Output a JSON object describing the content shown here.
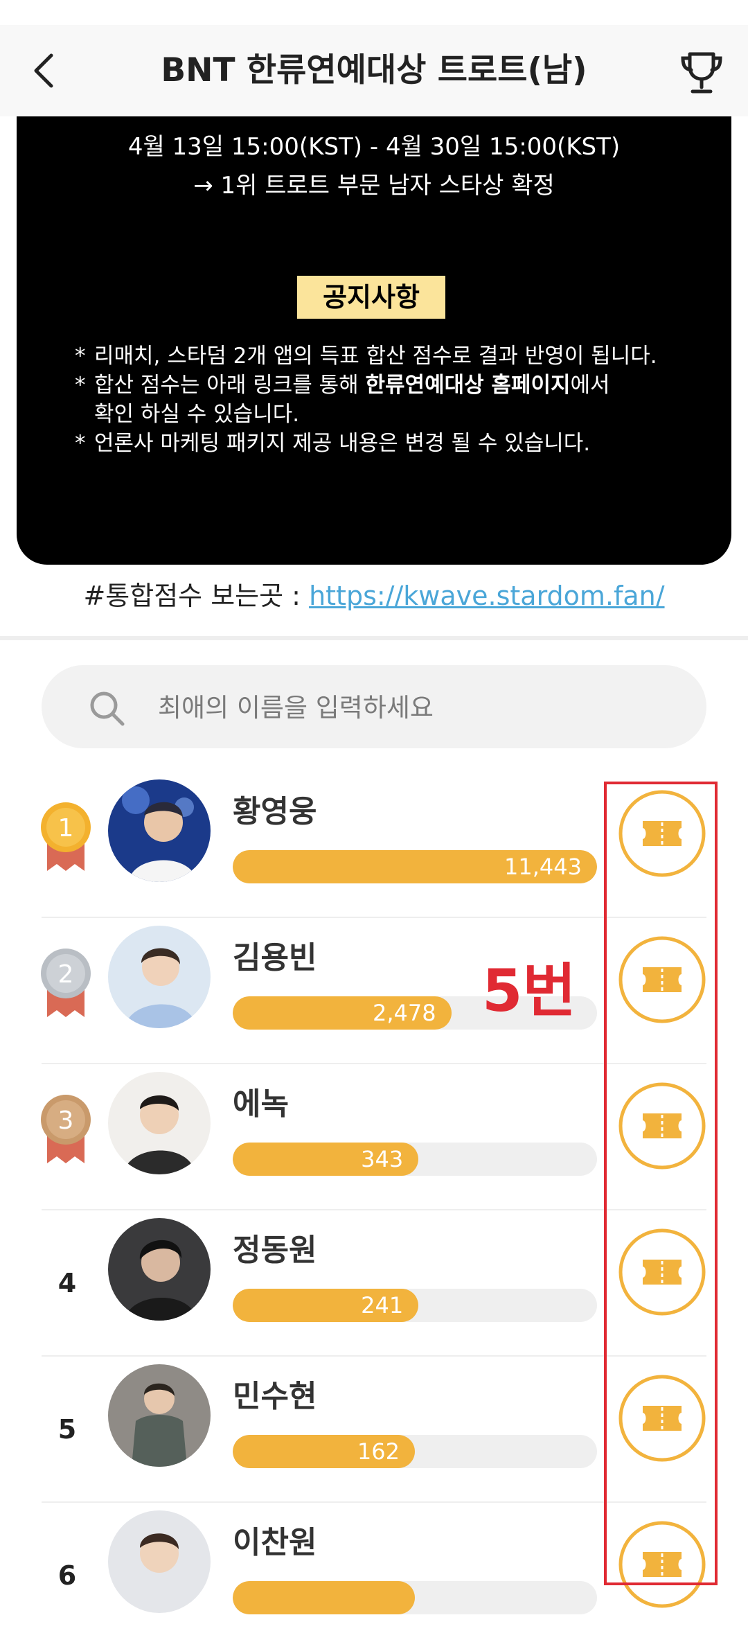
{
  "header": {
    "title": "BNT 한류연예대상 트로트(남)"
  },
  "banner": {
    "period": "4월 13일 15:00(KST) - 4월 30일 15:00(KST)",
    "prize": "→ 1위 트로트 부문 남자 스타상 확정",
    "notice_title": "공지사항",
    "notices": [
      "리매치, 스타덤 2개 앱의 득표 합산 점수로 결과 반영이 됩니다.",
      "합산 점수는 아래 링크를 통해 ",
      "확인 하실 수 있습니다.",
      "언론사 마케팅 패키지 제공 내용은 변경 될 수 있습니다."
    ],
    "notice_bold": "한류연예대상 홈페이지",
    "notice_after_bold": "에서",
    "star": "*"
  },
  "link_row": {
    "label": "#통합점수 보는곳 : ",
    "url": "https://kwave.stardom.fan/"
  },
  "search": {
    "placeholder": "최애의 이름을 입력하세요"
  },
  "ranking": [
    {
      "rank": "1",
      "name": "황영웅",
      "votes": "11,443",
      "fill": 1.0
    },
    {
      "rank": "2",
      "name": "김용빈",
      "votes": "2,478",
      "fill": 0.6
    },
    {
      "rank": "3",
      "name": "에녹",
      "votes": "343",
      "fill": 0.51
    },
    {
      "rank": "4",
      "name": "정동원",
      "votes": "241",
      "fill": 0.51
    },
    {
      "rank": "5",
      "name": "민수현",
      "votes": "162",
      "fill": 0.5
    },
    {
      "rank": "6",
      "name": "이찬원",
      "votes": "",
      "fill": 0.5
    }
  ],
  "annotation": {
    "text": "5번"
  },
  "colors": {
    "accent": "#f2b33d",
    "annotation": "#e02a33",
    "link": "#4aa6d8"
  }
}
